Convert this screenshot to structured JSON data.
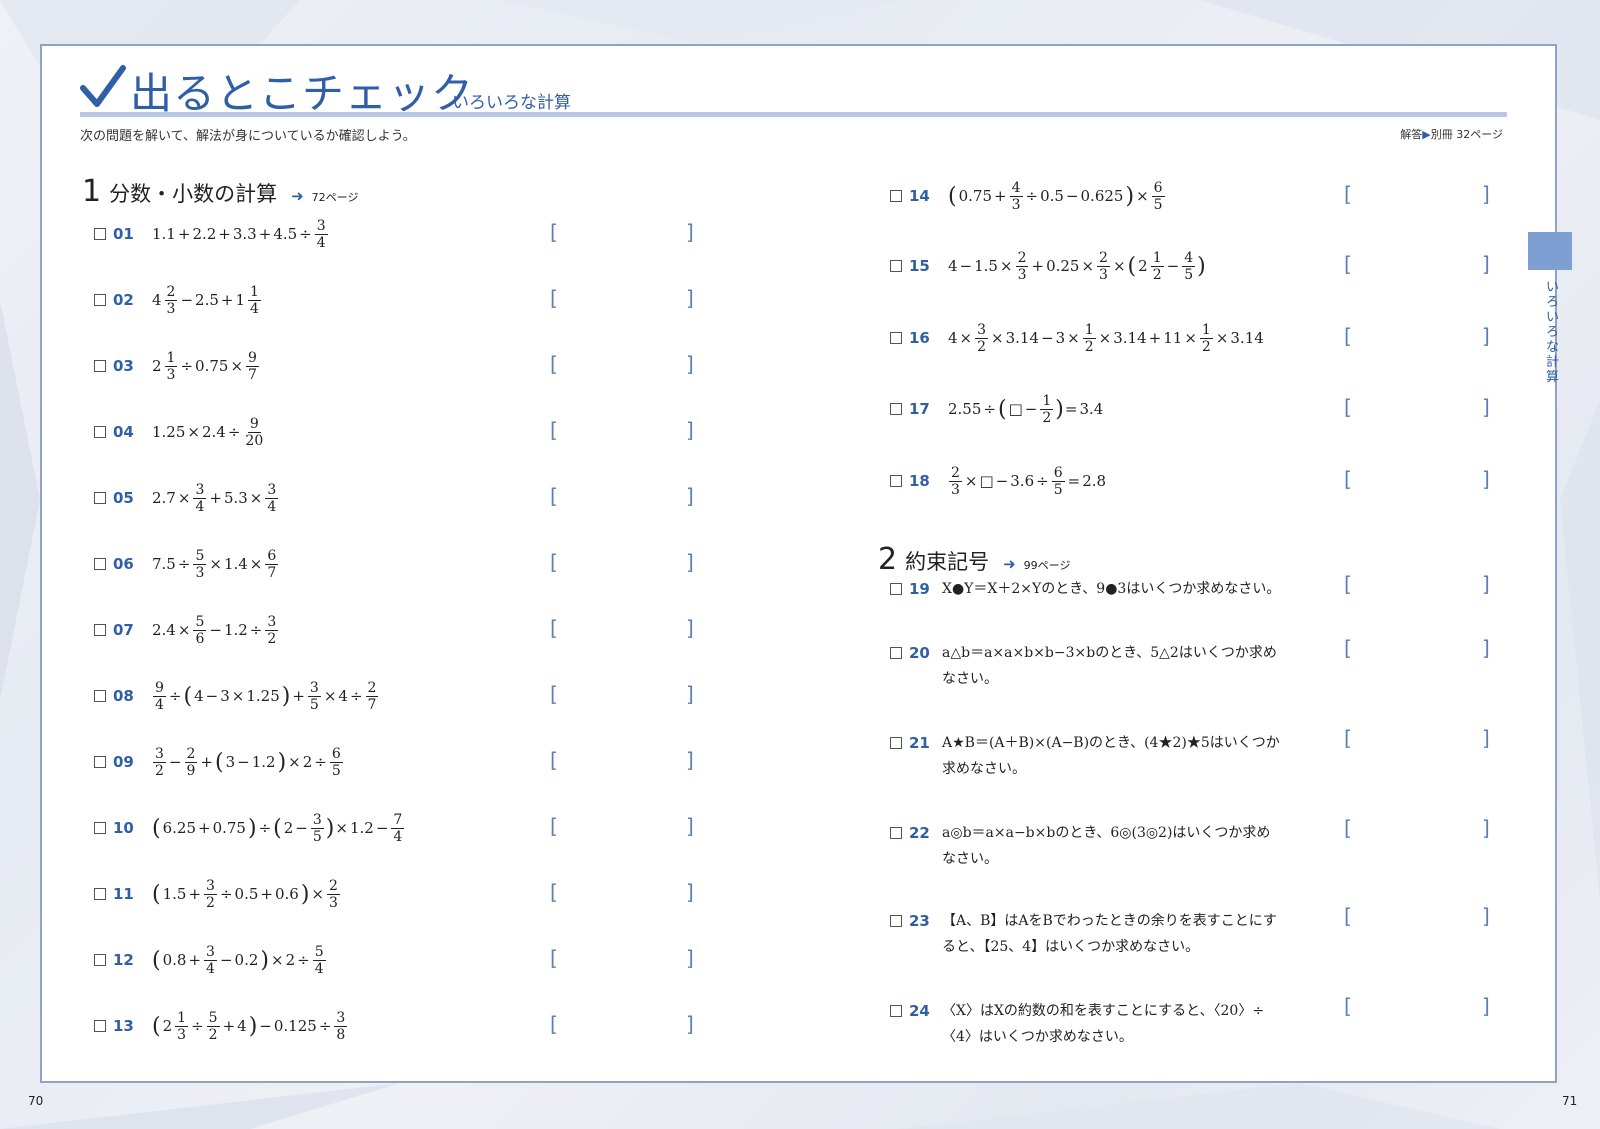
{
  "header": {
    "title": "出るとこチェック",
    "subtitle": "いろいろな計算",
    "instruction": "次の問題を解いて、解法が身についているか確認しよう。",
    "answer_ref_label": "解答",
    "answer_ref_location": "別冊 32ページ"
  },
  "side_tab": {
    "label": "いろいろな計算"
  },
  "sections": [
    {
      "number": "1",
      "title": "分数・小数の計算",
      "ref": "72ページ"
    },
    {
      "number": "2",
      "title": "約束記号",
      "ref": "99ページ"
    }
  ],
  "problems": [
    {
      "id": "01",
      "expr": "1.1 + 2.2 + 3.3 + 4.5 ÷ 3/4"
    },
    {
      "id": "02",
      "expr": "4 2/3 − 2.5 + 1 1/4"
    },
    {
      "id": "03",
      "expr": "2 1/3 ÷ 0.75 × 9/7"
    },
    {
      "id": "04",
      "expr": "1.25 × 2.4 ÷ 9/20"
    },
    {
      "id": "05",
      "expr": "2.7 × 3/4 + 5.3 × 3/4"
    },
    {
      "id": "06",
      "expr": "7.5 ÷ 5/3 × 1.4 × 6/7"
    },
    {
      "id": "07",
      "expr": "2.4 × 5/6 − 1.2 ÷ 3/2"
    },
    {
      "id": "08",
      "expr": "9/4 ÷ (4 − 3 × 1.25) + 3/5 × 4 ÷ 2/7"
    },
    {
      "id": "09",
      "expr": "3/2 − 2/9 + (3 − 1.2) × 2 ÷ 6/5"
    },
    {
      "id": "10",
      "expr": "(6.25 + 0.75) ÷ (2 − 3/5) × 1.2 − 7/4"
    },
    {
      "id": "11",
      "expr": "(1.5 + 3/2 ÷ 0.5 + 0.6) × 2/3"
    },
    {
      "id": "12",
      "expr": "(0.8 + 3/4 − 0.2) × 2 ÷ 5/4"
    },
    {
      "id": "13",
      "expr": "(2 1/3 ÷ 5/2 + 4) − 0.125 ÷ 3/8"
    },
    {
      "id": "14",
      "expr": "(0.75 + 4/3 ÷ 0.5 − 0.625) × 6/5"
    },
    {
      "id": "15",
      "expr": "4 − 1.5 × 2/3 + 0.25 × 2/3 × (2 1/2 − 4/5)"
    },
    {
      "id": "16",
      "expr": "4 × 3/2 × 3.14 − 3 × 1/2 × 3.14 + 11 × 1/2 × 3.14"
    },
    {
      "id": "17",
      "expr": "2.55 ÷ (□ − 1/2) = 3.4"
    },
    {
      "id": "18",
      "expr": "2/3 × □ − 3.6 ÷ 6/5 = 2.8"
    },
    {
      "id": "19",
      "text": "X●Y＝X＋2×Yのとき、9●3はいくつか求めなさい。"
    },
    {
      "id": "20",
      "text": "a△b＝a×a×b×b−3×bのとき、5△2はいくつか求めなさい。"
    },
    {
      "id": "21",
      "text": "A★B＝(A＋B)×(A−B)のとき、(4★2)★5はいくつか求めなさい。"
    },
    {
      "id": "22",
      "text": "a◎b＝a×a−b×bのとき、6◎(3◎2)はいくつか求めなさい。"
    },
    {
      "id": "23",
      "text": "【A、B】はAをBでわったときの余りを表すことにすると、【25、4】はいくつか求めなさい。"
    },
    {
      "id": "24",
      "text": "〈X〉はXの約数の和を表すことにすると、〈20〉÷〈4〉はいくつか求めなさい。"
    }
  ],
  "answer_bracket_open": "[",
  "answer_bracket_close": "]",
  "page_numbers": {
    "left": "70",
    "right": "71"
  },
  "colors": {
    "accent": "#2f5fa6",
    "rule": "#b9c6e2",
    "frame": "#8ea3c8",
    "tab": "#7f9fd2"
  }
}
